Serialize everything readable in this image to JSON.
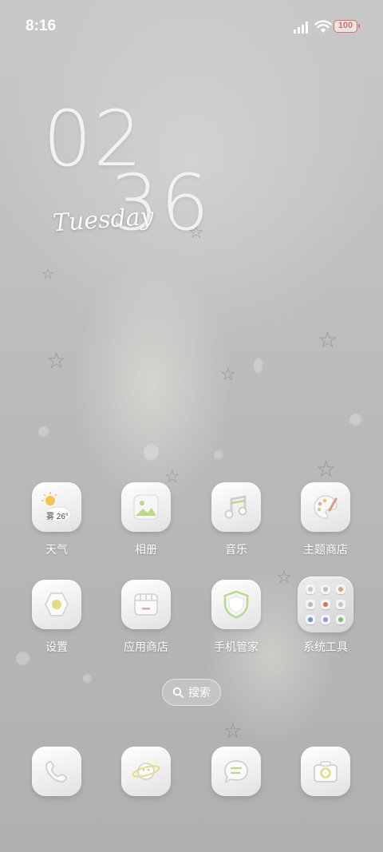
{
  "status_bar": {
    "time": "8:16",
    "battery": "100"
  },
  "clock": {
    "hour": "02",
    "minute": "36",
    "day": "Tuesday"
  },
  "apps": [
    {
      "label": "天气",
      "icon": "weather-icon",
      "weather_text": "雾 26°"
    },
    {
      "label": "相册",
      "icon": "gallery-icon"
    },
    {
      "label": "音乐",
      "icon": "music-icon"
    },
    {
      "label": "主题商店",
      "icon": "theme-store-icon"
    },
    {
      "label": "设置",
      "icon": "settings-icon"
    },
    {
      "label": "应用商店",
      "icon": "app-store-icon"
    },
    {
      "label": "手机管家",
      "icon": "phone-manager-icon"
    },
    {
      "label": "系统工具",
      "icon": "system-tools-folder-icon"
    }
  ],
  "search": {
    "label": "搜索"
  },
  "dock": [
    {
      "icon": "phone-icon"
    },
    {
      "icon": "browser-icon"
    },
    {
      "icon": "messages-icon"
    },
    {
      "icon": "camera-icon"
    }
  ],
  "colors": {
    "accent_green": "#b9d98a",
    "battery": "#d8735f",
    "icon_bg": "#f2f2f2"
  }
}
